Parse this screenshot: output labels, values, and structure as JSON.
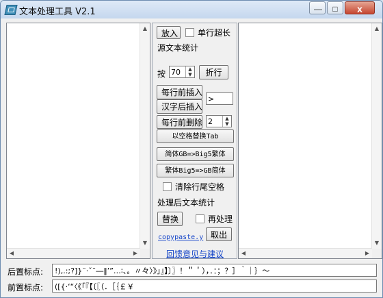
{
  "window": {
    "title": "文本处理工具 V2.1",
    "minimize": "—",
    "maximize": "□",
    "close": "x"
  },
  "controls": {
    "place_button": "放入",
    "single_line_exceed": "单行超长",
    "source_stats": "源文本统计",
    "per_label": "按",
    "per_value": "70",
    "wrap_button": "折行",
    "insert_before_button": "每行前插入",
    "insert_after_han_button": "汉字后插入",
    "insert_value": ">",
    "delete_before_button": "每行前删除",
    "delete_value": "2",
    "replace_space_tab_button": "以空格替换Tab",
    "simplified_to_big5_button": "简体GB=>Big5繁体",
    "traditional_to_gb_button": "繁体Big5=>GB简体",
    "clear_trailing_space": "清除行尾空格",
    "processed_stats": "处理后文本统计",
    "replace_button": "替换",
    "reprocess": "再处理",
    "take_out_button": "取出",
    "copy_link": "copypaste.y",
    "feedback_link": "回馈意见与建议"
  },
  "bottom": {
    "suffix_label": "后置标点:",
    "suffix_value": "!),.:;?]}¨·ˇˉ―‖’”…∶、。〃々〉》」』】〕〗！＂＇），．：；？］｀｜｝～",
    "prefix_label": "前置标点:",
    "prefix_value": "([{·‘“〈《「『【〔〖（．［｛￡￥"
  },
  "icons": {
    "app": "app-icon",
    "spin": "spin-arrows",
    "scroll": "scroll-arrows"
  }
}
